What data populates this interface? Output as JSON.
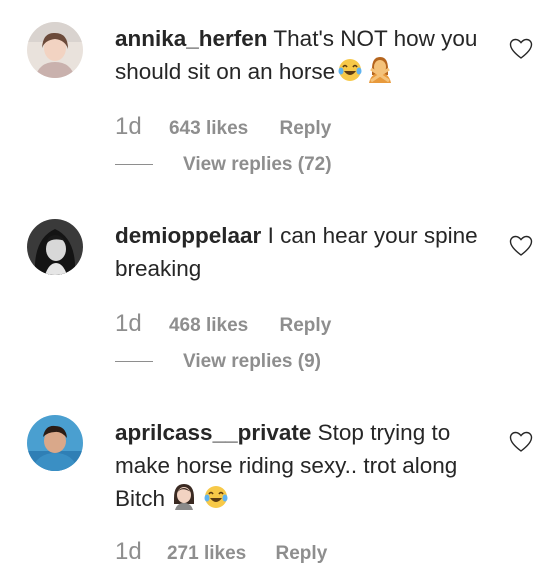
{
  "comments": [
    {
      "username": "annika_herfen",
      "text": "That's NOT how you should sit on an horse",
      "emojis": [
        "tears-of-joy-emoji",
        "woman-gesturing-no-emoji"
      ],
      "time": "1d",
      "likes": "643 likes",
      "reply": "Reply",
      "view_replies": "View replies (72)"
    },
    {
      "username": "demioppelaar",
      "text": "I can hear your spine breaking",
      "emojis": [],
      "time": "1d",
      "likes": "468 likes",
      "reply": "Reply",
      "view_replies": "View replies (9)"
    },
    {
      "username": "aprilcass__private",
      "text": "Stop trying to make horse riding sexy.. trot along Bitch",
      "emojis": [
        "woman-emoji",
        "tears-of-joy-emoji"
      ],
      "time": "1d",
      "likes": "271 likes",
      "reply": "Reply"
    }
  ],
  "icons": {
    "like": "heart-outline-icon"
  },
  "colors": {
    "text": "#262626",
    "secondary": "#8e8e8e",
    "background": "#ffffff"
  }
}
